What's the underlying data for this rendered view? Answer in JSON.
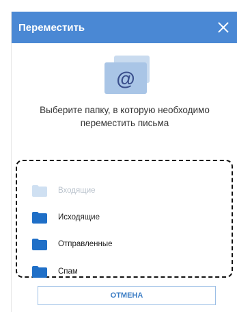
{
  "dialog": {
    "title": "Переместить",
    "prompt_line1": "Выберите папку, в которую необходимо",
    "prompt_line2": "переместить письма",
    "cancel_label": "ОТМЕНА"
  },
  "icons": {
    "close": "close-icon",
    "illustration": "envelope-at-icon",
    "folder": "folder-icon"
  },
  "folders": [
    {
      "label": "Входящие",
      "disabled": true
    },
    {
      "label": "Исходящие",
      "disabled": false
    },
    {
      "label": "Отправленные",
      "disabled": false
    },
    {
      "label": "Спам",
      "disabled": false
    }
  ],
  "colors": {
    "header": "#4a88d4",
    "folder_active": "#1f6fc7",
    "folder_disabled": "#cfe0f2",
    "accent": "#3a7cc4"
  }
}
